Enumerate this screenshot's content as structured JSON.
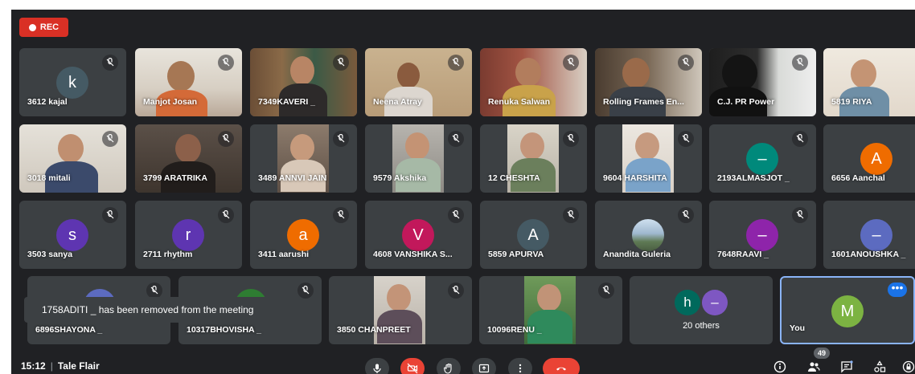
{
  "recording": {
    "label": "REC"
  },
  "participants": {
    "row1": [
      "3612 kajal",
      "Manjot Josan",
      "7349KAVERI _",
      "Neena Atray",
      "Renuka Salwan",
      "Rolling Frames En...",
      "C.J. PR Power",
      "5819 RIYA"
    ],
    "row2": [
      "3018 mitali",
      "3799 ARATRIKA",
      "3489 ANNVI JAIN",
      "9579 Akshika",
      "12 CHESHTA",
      "9604 HARSHITA",
      "2193ALMASJOT _",
      "6656 Aanchal"
    ],
    "row3": [
      "3503 sanya",
      "2711 rhythm",
      "3411 aarushi",
      "4608 VANSHIKA S...",
      "5859 APURVA",
      "Anandita Guleria",
      "7648RAAVI _",
      "1601ANOUSHKA _"
    ],
    "row4": [
      "6896SHAYONA _",
      "10317BHOVISHA _",
      "3850 CHANPREET",
      "10096RENU _"
    ]
  },
  "avatars": {
    "kajal": "k",
    "sanya": "s",
    "rhythm": "r",
    "aarushi": "a",
    "vanshika": "V",
    "apurva": "A",
    "aanchal": "A",
    "almasjot": "–",
    "raavi": "–",
    "anoushka": "–",
    "others_h": "h",
    "others_dash": "–",
    "you": "M"
  },
  "colors": {
    "kajal": "#455a64",
    "sanya": "#5e35b1",
    "rhythm": "#5e35b1",
    "aarushi": "#ef6c00",
    "vanshika": "#c2185b",
    "apurva": "#455a64",
    "aanchal": "#ef6c00",
    "almasjot": "#00897b",
    "raavi": "#8e24aa",
    "anoushka": "#5c6bc0",
    "others_h": "#00695c",
    "others_dash": "#7e57c2",
    "you": "#7cb342",
    "rec": "#d93025",
    "hangup": "#ea4335"
  },
  "others": {
    "label": "20 others"
  },
  "you": {
    "label": "You"
  },
  "toast": {
    "text": "1758ADITI _ has been removed from the meeting"
  },
  "footer": {
    "time": "15:12",
    "meeting": "Tale Flair",
    "people_count": "49"
  },
  "icons": [
    "mic-icon",
    "camera-off-icon",
    "raise-hand-icon",
    "present-icon",
    "more-options-icon",
    "hang-up-icon",
    "info-icon",
    "people-icon",
    "chat-icon",
    "activities-icon",
    "lock-icon",
    "mic-muted-icon"
  ]
}
